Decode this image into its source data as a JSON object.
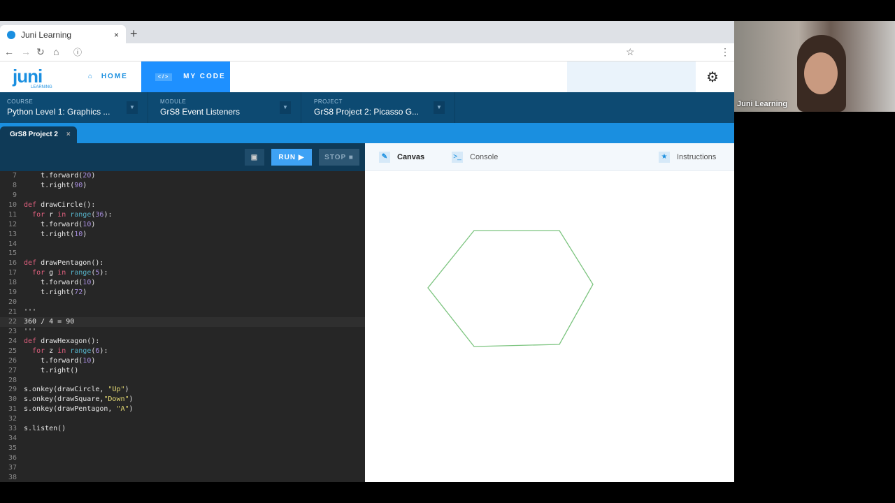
{
  "browser": {
    "tab_title": "Juni Learning",
    "close": "×",
    "new_tab": "+"
  },
  "app": {
    "logo": "juni",
    "logo_sub": "LEARNING",
    "nav": [
      {
        "label": "HOME",
        "icon": "home-icon"
      },
      {
        "label": "MY CODE",
        "icon": "code-icon"
      }
    ]
  },
  "breadcrumbs": [
    {
      "key": "COURSE",
      "value": "Python Level 1: Graphics ..."
    },
    {
      "key": "MODULE",
      "value": "GrS8 Event Listeners"
    },
    {
      "key": "PROJECT",
      "value": "GrS8 Project 2: Picasso G..."
    }
  ],
  "file_tab": {
    "label": "GrS8 Project 2",
    "close": "×"
  },
  "toolbar": {
    "run": "RUN ▶",
    "stop": "STOP ■",
    "save_icon": "save-icon"
  },
  "right_tabs": [
    {
      "label": "Canvas",
      "icon": "brush-icon"
    },
    {
      "label": "Console",
      "icon": "terminal-icon"
    },
    {
      "label": "Instructions",
      "icon": "star-icon"
    }
  ],
  "code": [
    {
      "n": "7",
      "t": "    t.forward(20)"
    },
    {
      "n": "8",
      "t": "    t.right(90)"
    },
    {
      "n": "9",
      "t": ""
    },
    {
      "n": "10",
      "t": "def drawCircle():"
    },
    {
      "n": "11",
      "t": "  for r in range(36):"
    },
    {
      "n": "12",
      "t": "    t.forward(10)"
    },
    {
      "n": "13",
      "t": "    t.right(10)"
    },
    {
      "n": "14",
      "t": ""
    },
    {
      "n": "15",
      "t": ""
    },
    {
      "n": "16",
      "t": "def drawPentagon():"
    },
    {
      "n": "17",
      "t": "  for g in range(5):"
    },
    {
      "n": "18",
      "t": "    t.forward(10)"
    },
    {
      "n": "19",
      "t": "    t.right(72)"
    },
    {
      "n": "20",
      "t": ""
    },
    {
      "n": "21",
      "t": "'''"
    },
    {
      "n": "22",
      "t": "360 / 4 = 90"
    },
    {
      "n": "23",
      "t": "'''"
    },
    {
      "n": "24",
      "t": "def drawHexagon():"
    },
    {
      "n": "25",
      "t": "  for z in range(6):"
    },
    {
      "n": "26",
      "t": "    t.forward(10)"
    },
    {
      "n": "27",
      "t": "    t.right()"
    },
    {
      "n": "28",
      "t": ""
    },
    {
      "n": "29",
      "t": "s.onkey(drawCircle, \"Up\")"
    },
    {
      "n": "30",
      "t": "s.onkey(drawSquare,\"Down\")"
    },
    {
      "n": "31",
      "t": "s.onkey(drawPentagon, \"A\")"
    },
    {
      "n": "32",
      "t": ""
    },
    {
      "n": "33",
      "t": "s.listen()"
    },
    {
      "n": "34",
      "t": ""
    },
    {
      "n": "35",
      "t": ""
    },
    {
      "n": "36",
      "t": ""
    },
    {
      "n": "37",
      "t": ""
    },
    {
      "n": "38",
      "t": ""
    }
  ],
  "canvas": {
    "shape": "hexagon",
    "stroke": "#7cc47f"
  },
  "webcam": {
    "name": "Juni Learning"
  },
  "colors": {
    "accent": "#1e90ff",
    "nav_dark": "#0d4a72",
    "editor_bg": "#262626"
  }
}
